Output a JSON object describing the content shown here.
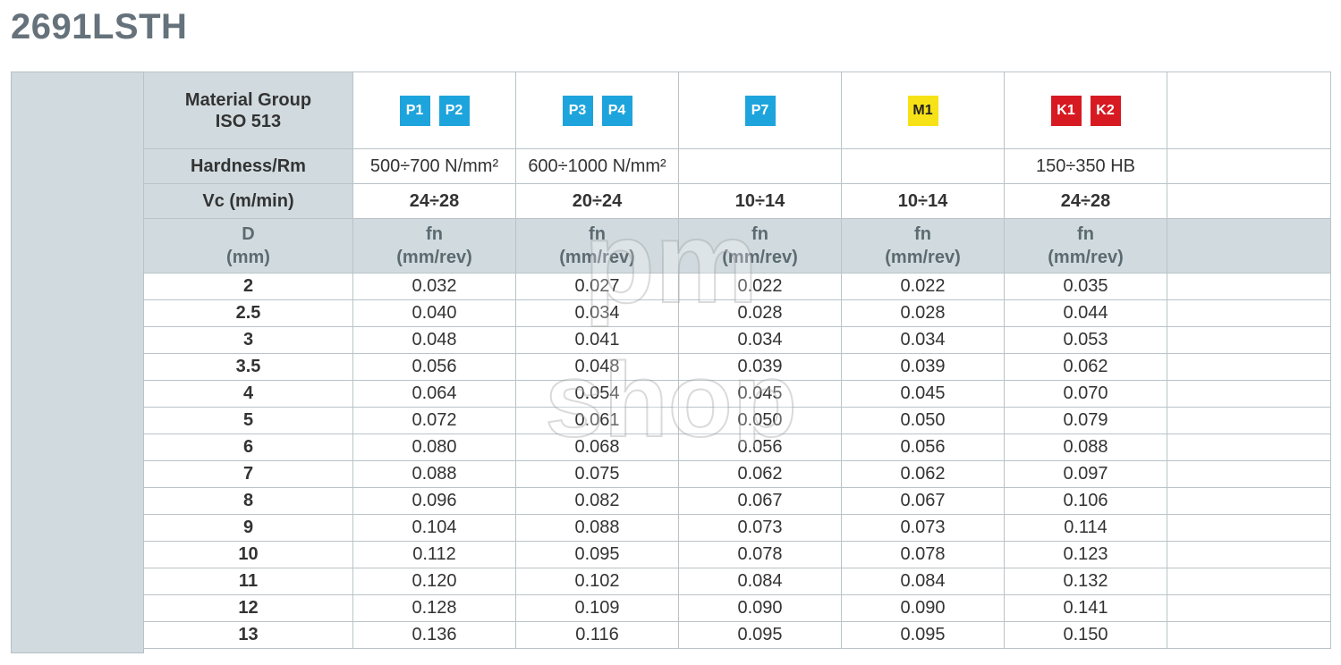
{
  "title": "2691LSTH",
  "labels": {
    "material_group_line1": "Material Group",
    "material_group_line2": "ISO 513",
    "hardness": "Hardness/Rm",
    "vc": "Vc (m/min)",
    "d_line1": "D",
    "d_line2": "(mm)",
    "fn_line1": "fn",
    "fn_line2": "(mm/rev)"
  },
  "groups": [
    {
      "badges": [
        {
          "text": "P1",
          "color": "blue"
        },
        {
          "text": "P2",
          "color": "blue"
        }
      ],
      "hardness": "500÷700 N/mm²",
      "vc": "24÷28"
    },
    {
      "badges": [
        {
          "text": "P3",
          "color": "blue"
        },
        {
          "text": "P4",
          "color": "blue"
        }
      ],
      "hardness": "600÷1000 N/mm²",
      "vc": "20÷24"
    },
    {
      "badges": [
        {
          "text": "P7",
          "color": "blue"
        }
      ],
      "hardness": "",
      "vc": "10÷14"
    },
    {
      "badges": [
        {
          "text": "M1",
          "color": "yellow"
        }
      ],
      "hardness": "",
      "vc": "10÷14"
    },
    {
      "badges": [
        {
          "text": "K1",
          "color": "red"
        },
        {
          "text": "K2",
          "color": "red"
        }
      ],
      "hardness": "150÷350 HB",
      "vc": "24÷28"
    }
  ],
  "badge_colors": {
    "blue": "#1ea4dc",
    "yellow": "#f6e217",
    "red": "#d71a22"
  },
  "rows": [
    {
      "d": "2",
      "fn": [
        "0.032",
        "0.027",
        "0.022",
        "0.022",
        "0.035"
      ]
    },
    {
      "d": "2.5",
      "fn": [
        "0.040",
        "0.034",
        "0.028",
        "0.028",
        "0.044"
      ]
    },
    {
      "d": "3",
      "fn": [
        "0.048",
        "0.041",
        "0.034",
        "0.034",
        "0.053"
      ]
    },
    {
      "d": "3.5",
      "fn": [
        "0.056",
        "0.048",
        "0.039",
        "0.039",
        "0.062"
      ]
    },
    {
      "d": "4",
      "fn": [
        "0.064",
        "0.054",
        "0.045",
        "0.045",
        "0.070"
      ]
    },
    {
      "d": "5",
      "fn": [
        "0.072",
        "0.061",
        "0.050",
        "0.050",
        "0.079"
      ]
    },
    {
      "d": "6",
      "fn": [
        "0.080",
        "0.068",
        "0.056",
        "0.056",
        "0.088"
      ]
    },
    {
      "d": "7",
      "fn": [
        "0.088",
        "0.075",
        "0.062",
        "0.062",
        "0.097"
      ]
    },
    {
      "d": "8",
      "fn": [
        "0.096",
        "0.082",
        "0.067",
        "0.067",
        "0.106"
      ]
    },
    {
      "d": "9",
      "fn": [
        "0.104",
        "0.088",
        "0.073",
        "0.073",
        "0.114"
      ]
    },
    {
      "d": "10",
      "fn": [
        "0.112",
        "0.095",
        "0.078",
        "0.078",
        "0.123"
      ]
    },
    {
      "d": "11",
      "fn": [
        "0.120",
        "0.102",
        "0.084",
        "0.084",
        "0.132"
      ]
    },
    {
      "d": "12",
      "fn": [
        "0.128",
        "0.109",
        "0.090",
        "0.090",
        "0.141"
      ]
    },
    {
      "d": "13",
      "fn": [
        "0.136",
        "0.116",
        "0.095",
        "0.095",
        "0.150"
      ]
    }
  ],
  "watermark": {
    "line1": "pm",
    "line2": "shop"
  }
}
